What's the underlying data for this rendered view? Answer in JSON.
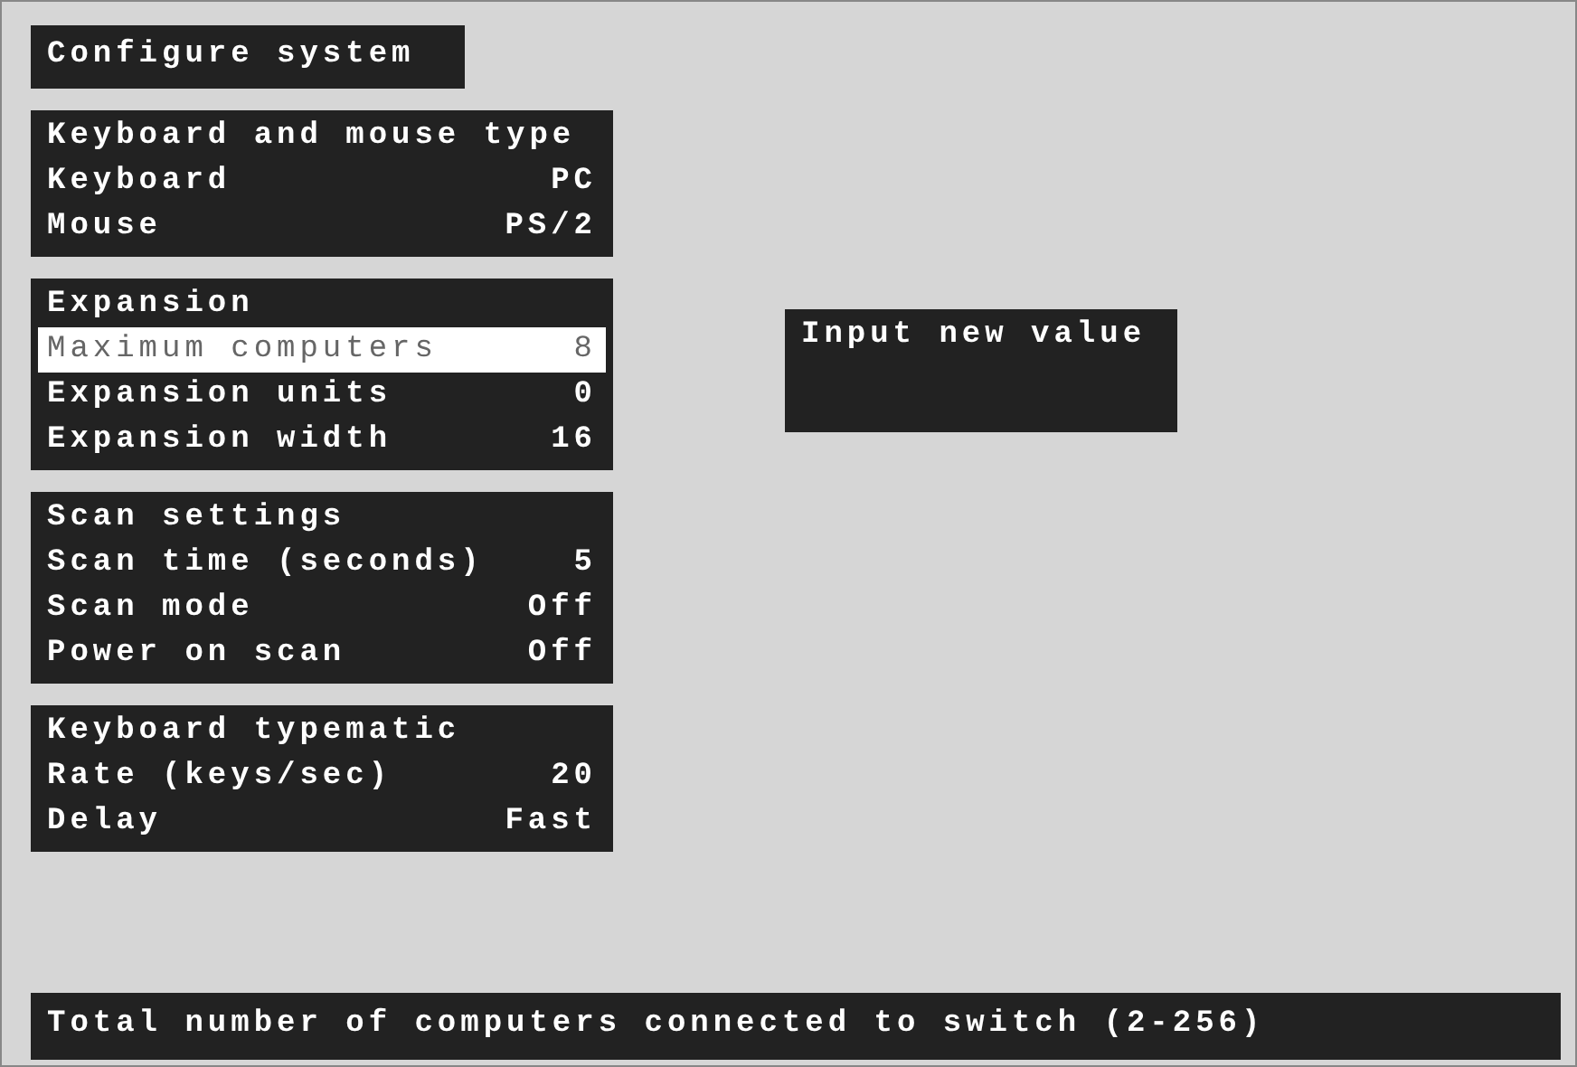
{
  "title": "Configure system",
  "panels": [
    {
      "title": "Keyboard and mouse type",
      "rows": [
        {
          "label": "Keyboard",
          "value": "PC",
          "selected": false
        },
        {
          "label": "Mouse",
          "value": "PS/2",
          "selected": false
        }
      ]
    },
    {
      "title": "Expansion",
      "rows": [
        {
          "label": "Maximum computers",
          "value": "8",
          "selected": true
        },
        {
          "label": "Expansion units",
          "value": "0",
          "selected": false
        },
        {
          "label": "Expansion width",
          "value": "16",
          "selected": false
        }
      ]
    },
    {
      "title": "Scan settings",
      "rows": [
        {
          "label": "Scan time (seconds)",
          "value": "5",
          "selected": false
        },
        {
          "label": "Scan mode",
          "value": "Off",
          "selected": false
        },
        {
          "label": "Power on scan",
          "value": "Off",
          "selected": false
        }
      ]
    },
    {
      "title": "Keyboard typematic",
      "rows": [
        {
          "label": "Rate (keys/sec)",
          "value": "20",
          "selected": false
        },
        {
          "label": "Delay",
          "value": "Fast",
          "selected": false
        }
      ]
    }
  ],
  "prompt": {
    "title": "Input new value"
  },
  "status_bar": "Total number of computers connected to switch (2-256)"
}
